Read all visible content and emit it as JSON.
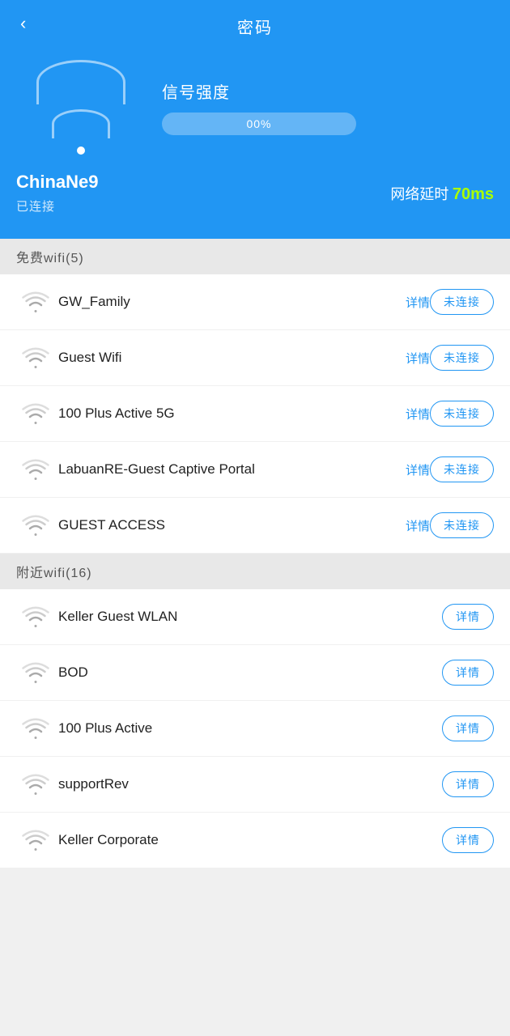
{
  "header": {
    "back_label": "‹",
    "title": "密码",
    "wifi_name": "ChinaNe9",
    "connected_status": "已连接",
    "signal_label": "信号强度",
    "signal_percent": "00%",
    "signal_fill": "0",
    "delay_label": "网络延时",
    "delay_value": "70ms"
  },
  "free_wifi_section": {
    "label": "免费wifi(5)",
    "items": [
      {
        "name": "GW_Family",
        "detail": "详情",
        "action": "未连接"
      },
      {
        "name": "Guest Wifi",
        "detail": "详情",
        "action": "未连接"
      },
      {
        "name": "100 Plus Active 5G",
        "detail": "详情",
        "action": "未连接"
      },
      {
        "name": "LabuanRE-Guest Captive Portal",
        "detail": "详情",
        "action": "未连接"
      },
      {
        "name": "GUEST ACCESS",
        "detail": "详情",
        "action": "未连接"
      }
    ]
  },
  "nearby_wifi_section": {
    "label": "附近wifi(16)",
    "items": [
      {
        "name": "Keller Guest WLAN",
        "action": "详情"
      },
      {
        "name": "BOD",
        "action": "详情"
      },
      {
        "name": "100 Plus Active",
        "action": "详情"
      },
      {
        "name": "supportRev",
        "action": "详情"
      },
      {
        "name": "Keller Corporate",
        "action": "详情"
      }
    ]
  },
  "colors": {
    "blue": "#2196f3",
    "green": "#aaff00",
    "section_bg": "#e8e8e8"
  }
}
